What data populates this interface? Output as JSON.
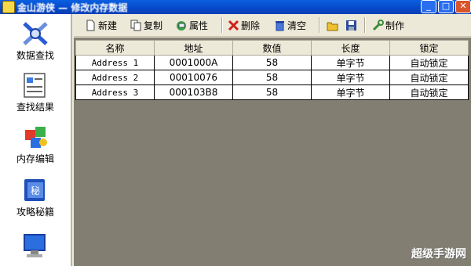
{
  "window": {
    "title": "金山游侠 — 修改内存数据",
    "controls": {
      "minimize": "_",
      "maximize": "□",
      "close": "✕"
    }
  },
  "sidebar": {
    "items": [
      {
        "label": "数据查找",
        "icon": "search-tools-icon"
      },
      {
        "label": "查找结果",
        "icon": "result-list-icon"
      },
      {
        "label": "内存编辑",
        "icon": "memory-edit-icon"
      },
      {
        "label": "攻略秘籍",
        "icon": "guide-book-icon"
      },
      {
        "label": "",
        "icon": "computer-icon"
      }
    ]
  },
  "toolbar": {
    "new_label": "新建",
    "copy_label": "复制",
    "props_label": "属性",
    "delete_label": "删除",
    "clear_label": "清空",
    "make_label": "制作"
  },
  "table": {
    "columns": [
      "名称",
      "地址",
      "数值",
      "长度",
      "锁定"
    ],
    "rows": [
      [
        "Address 1",
        "0001000A",
        "58",
        "单字节",
        "自动锁定"
      ],
      [
        "Address 2",
        "00010076",
        "58",
        "单字节",
        "自动锁定"
      ],
      [
        "Address 3",
        "000103B8",
        "58",
        "单字节",
        "自动锁定"
      ]
    ]
  },
  "watermark": "超级手游网",
  "colors": {
    "titlebar": "#0648c8",
    "panel": "#ece9d8",
    "grid_bg": "#827f72",
    "sidebar": "#ffffff"
  }
}
